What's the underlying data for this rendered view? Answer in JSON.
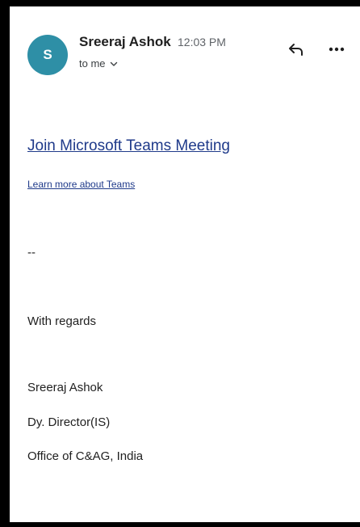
{
  "header": {
    "avatar_letter": "S",
    "avatar_color": "#2e8fa6",
    "sender_name": "Sreeraj Ashok",
    "time": "12:03 PM",
    "recipient": "to me",
    "recipient_chevron_icon": "chevron-down-icon",
    "reply_icon": "reply-icon",
    "more_icon": "more-horizontal-icon"
  },
  "body": {
    "join_link": "Join Microsoft Teams Meeting",
    "learn_link": "Learn more about Teams",
    "separator": "--",
    "closing": "With regards",
    "signature": {
      "name": "Sreeraj Ashok",
      "title": "Dy. Director(IS)",
      "organization": "Office of C&AG, India"
    }
  },
  "colors": {
    "link": "#1f3a8a",
    "frame": "#000000"
  }
}
